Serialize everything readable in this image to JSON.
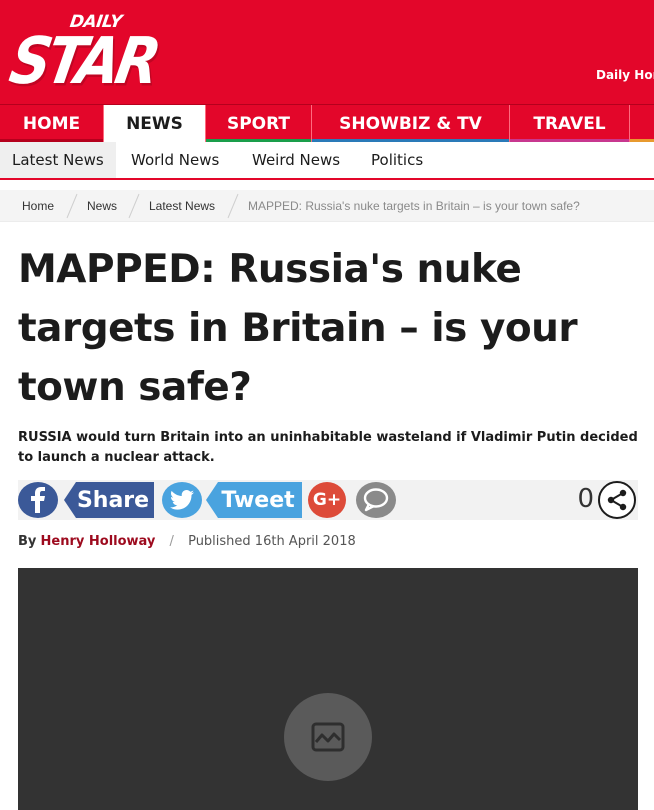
{
  "brand": {
    "logo_top": "DAILY",
    "logo_main": "STAR",
    "horoscope_link": "Daily Horo",
    "brand_color": "#e3062a"
  },
  "main_nav": [
    {
      "label": "HOME",
      "accent": "#e3062a",
      "active": false
    },
    {
      "label": "NEWS",
      "accent": "#e3062a",
      "active": true
    },
    {
      "label": "SPORT",
      "accent": "#1a9e4b",
      "active": false
    },
    {
      "label": "SHOWBIZ & TV",
      "accent": "#2a7ab8",
      "active": false
    },
    {
      "label": "TRAVEL",
      "accent": "#c8378f",
      "active": false
    }
  ],
  "sub_nav": [
    "Latest News",
    "World News",
    "Weird News",
    "Politics"
  ],
  "breadcrumb": [
    "Home",
    "News",
    "Latest News",
    "MAPPED: Russia's nuke targets in Britain – is your town safe?"
  ],
  "article": {
    "headline_lines": [
      "MAPPED: Russia's nuke",
      "targets in Britain – is your",
      "town safe?"
    ],
    "standfirst": "RUSSIA would turn Britain into an uninhabitable wasteland if Vladimir Putin decided to launch a nuclear attack.",
    "byline_prefix": "By",
    "author": "Henry Holloway",
    "published": "Published 16th April 2018"
  },
  "share": {
    "facebook_label": "Share",
    "twitter_label": "Tweet",
    "google_label": "G+",
    "count": "0",
    "icons": [
      "facebook-icon",
      "twitter-icon",
      "google-plus-icon",
      "comment-icon",
      "share-icon"
    ]
  },
  "video": {
    "icon": "broken-image-icon"
  }
}
